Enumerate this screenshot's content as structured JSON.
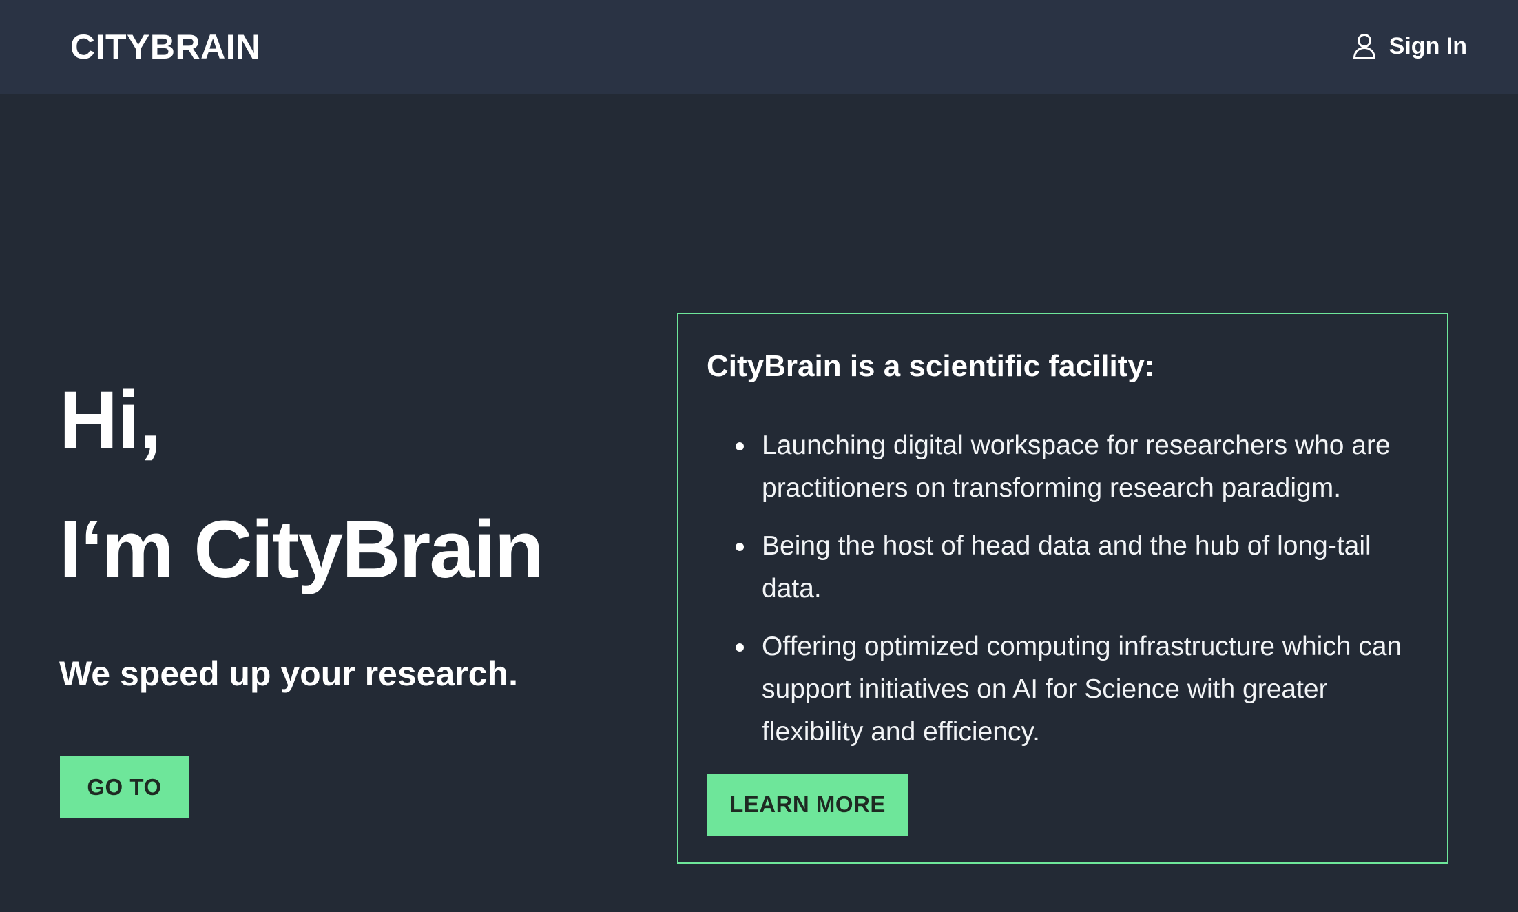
{
  "header": {
    "brand": "CITYBRAIN",
    "signin_label": "Sign In",
    "signin_icon": "user-icon"
  },
  "hero": {
    "line1": "Hi,",
    "line2": "I‘m CityBrain",
    "tagline": "We speed up your research.",
    "goto_label": "GO TO"
  },
  "info": {
    "title": "CityBrain is a scientific facility:",
    "items": [
      "Launching digital workspace for researchers who are practitioners on transforming research paradigm.",
      "Being the host of head data and the hub of long-tail data.",
      "Offering optimized computing infrastructure which can support initiatives on AI for Science with greater flexibility and efficiency."
    ],
    "learn_more_label": "LEARN MORE"
  },
  "colors": {
    "background": "#232a35",
    "header_background": "#2a3344",
    "accent_green": "#6ee69a",
    "button_text": "#1e2a22",
    "text": "#ffffff"
  }
}
